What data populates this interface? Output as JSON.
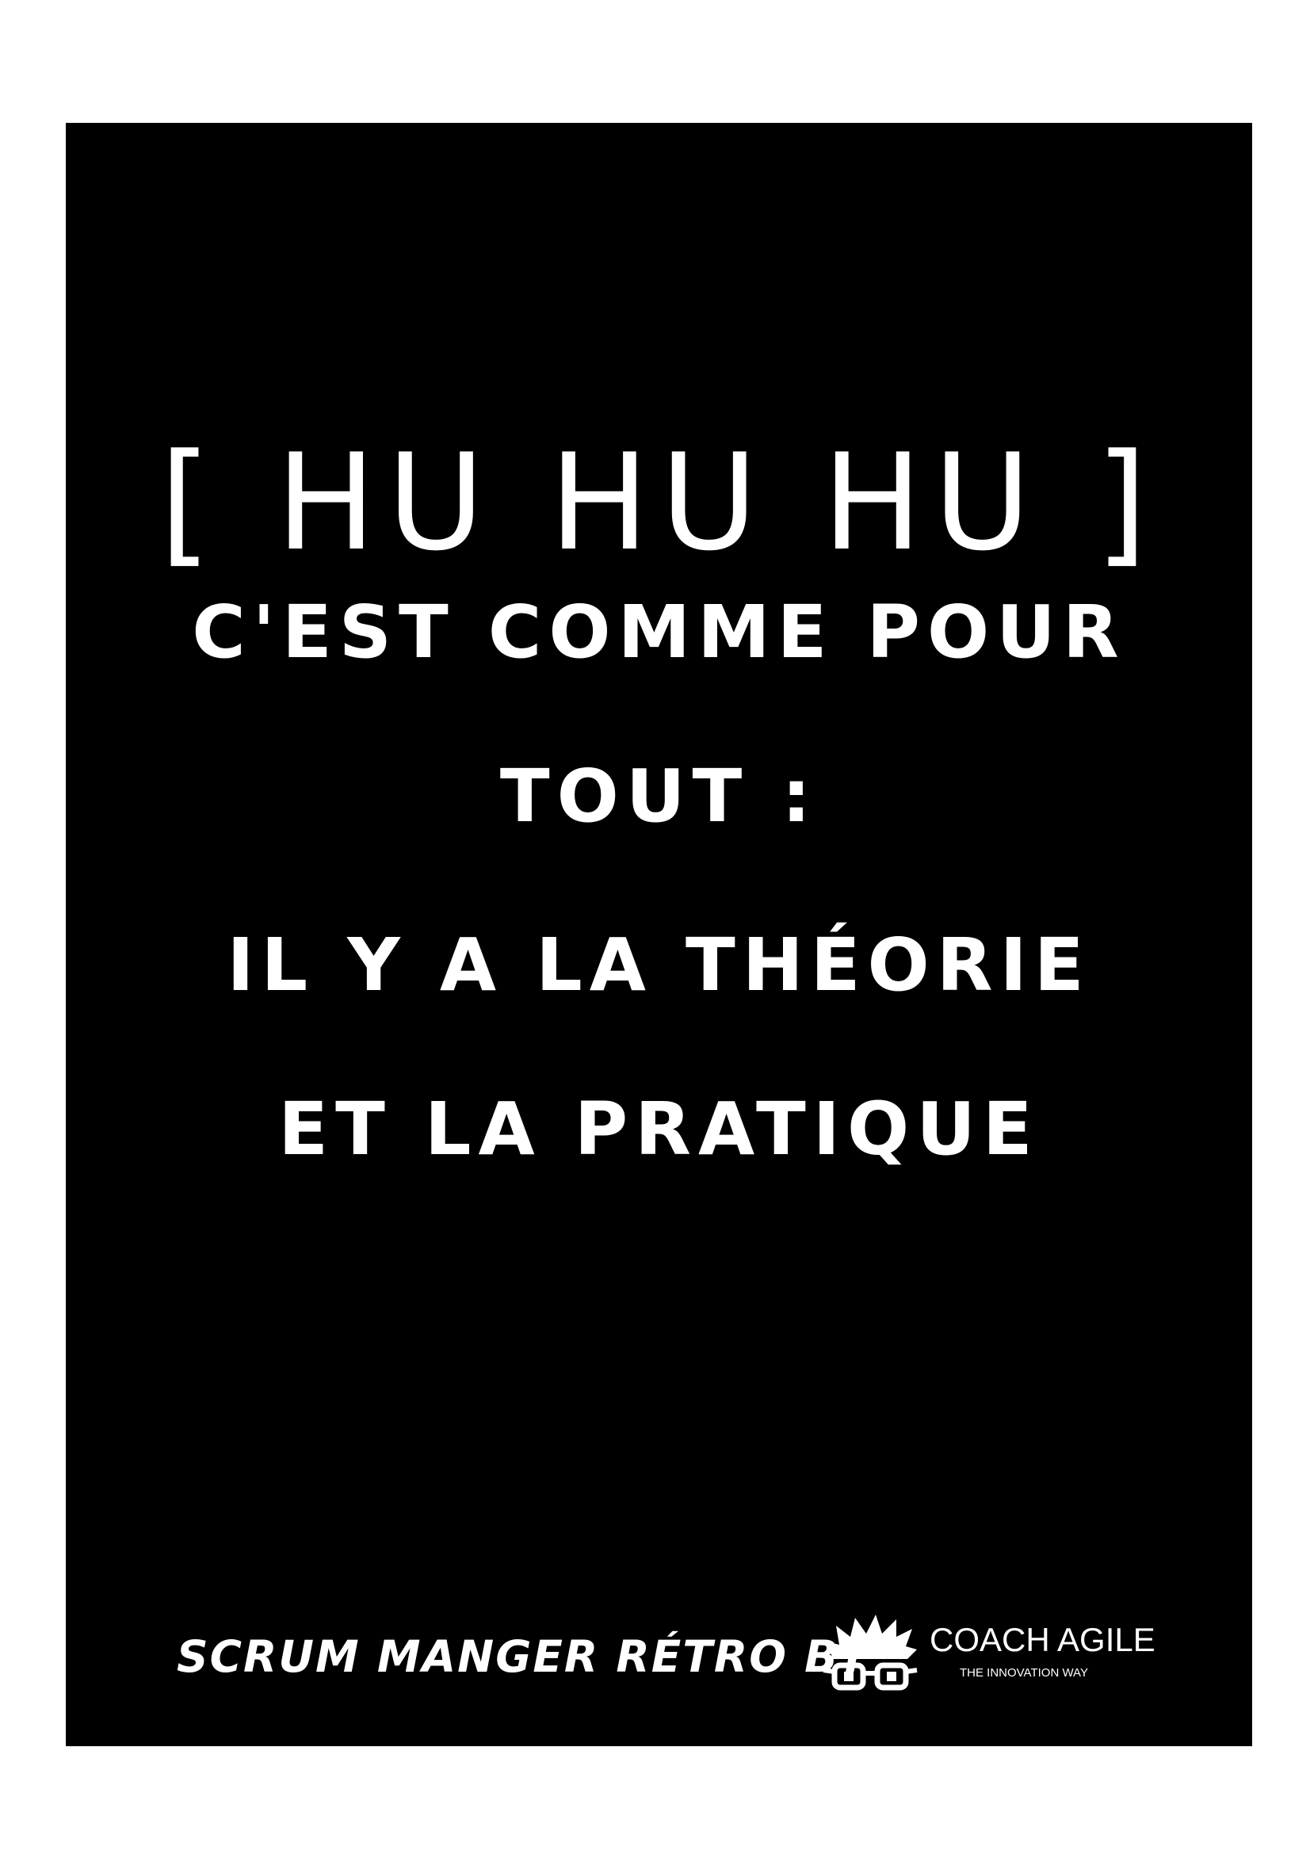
{
  "poster": {
    "title": "[ HU HU HU ]",
    "quote_lines": [
      "C'EST COMME POUR",
      "TOUT :",
      "IL Y A LA THÉORIE",
      "ET LA PRATIQUE"
    ]
  },
  "footer": {
    "credit": "SCRUM MANGER RÉTRO BY",
    "brand_name": "COACH AGILE",
    "brand_tagline": "THE INNOVATION WAY",
    "logo_icon": "nerd-face-glasses-icon"
  },
  "colors": {
    "background": "#ffffff",
    "card": "#000000",
    "text": "#ffffff"
  }
}
